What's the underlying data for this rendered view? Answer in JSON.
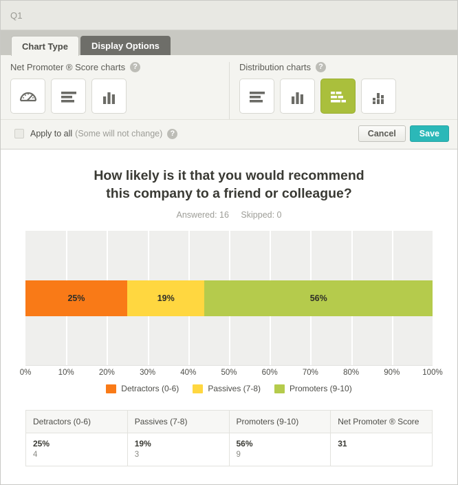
{
  "window": {
    "title": "Q1"
  },
  "tabs": [
    {
      "label": "Chart Type",
      "active": true
    },
    {
      "label": "Display Options",
      "active": false
    }
  ],
  "nps_section": {
    "heading": "Net Promoter ® Score charts",
    "help_glyph": "?",
    "options": [
      {
        "name": "gauge-chart",
        "selected": false
      },
      {
        "name": "horizontal-bar-chart",
        "selected": false
      },
      {
        "name": "vertical-bar-chart",
        "selected": false
      }
    ]
  },
  "distribution_section": {
    "heading": "Distribution charts",
    "help_glyph": "?",
    "options": [
      {
        "name": "horizontal-bar-chart",
        "selected": false
      },
      {
        "name": "vertical-bar-chart",
        "selected": false
      },
      {
        "name": "stacked-horizontal-bar-chart",
        "selected": true
      },
      {
        "name": "stacked-vertical-bar-chart",
        "selected": false
      }
    ]
  },
  "apply_row": {
    "checkbox_checked": false,
    "label": "Apply to all",
    "sublabel": "(Some will not change)",
    "help_glyph": "?",
    "cancel_label": "Cancel",
    "save_label": "Save"
  },
  "chart_data": {
    "type": "bar",
    "orientation": "horizontal-stacked",
    "title": "How likely is it that you would recommend this company to a friend or colleague?",
    "title_line1": "How likely is it that you would recommend",
    "title_line2": "this company to a friend or colleague?",
    "answered_label": "Answered: 16",
    "skipped_label": "Skipped: 0",
    "answered": 16,
    "skipped": 0,
    "categories": [
      "Detractors (0-6)",
      "Passives (7-8)",
      "Promoters (9-10)"
    ],
    "values": [
      25,
      19,
      56
    ],
    "value_labels": [
      "25%",
      "19%",
      "56%"
    ],
    "counts": [
      4,
      3,
      9
    ],
    "colors": [
      "#f97a17",
      "#ffd740",
      "#b5cb4c"
    ],
    "xlabel": "",
    "ylabel": "",
    "xlim": [
      0,
      100
    ],
    "xticks": [
      0,
      10,
      20,
      30,
      40,
      50,
      60,
      70,
      80,
      90,
      100
    ],
    "xtick_labels": [
      "0%",
      "10%",
      "20%",
      "30%",
      "40%",
      "50%",
      "60%",
      "70%",
      "80%",
      "90%",
      "100%"
    ],
    "grid": true,
    "legend_position": "bottom",
    "legend": [
      {
        "label": "Detractors (0-6)",
        "color": "#f97a17"
      },
      {
        "label": "Passives (7-8)",
        "color": "#ffd740"
      },
      {
        "label": "Promoters (9-10)",
        "color": "#b5cb4c"
      }
    ],
    "plot_background": "#efefed"
  },
  "table": {
    "headers": [
      "Detractors (0-6)",
      "Passives (7-8)",
      "Promoters (9-10)",
      "Net Promoter ® Score"
    ],
    "row": [
      {
        "percent": "25%",
        "count": "4"
      },
      {
        "percent": "19%",
        "count": "3"
      },
      {
        "percent": "56%",
        "count": "9"
      },
      {
        "percent": "31",
        "count": ""
      }
    ]
  }
}
